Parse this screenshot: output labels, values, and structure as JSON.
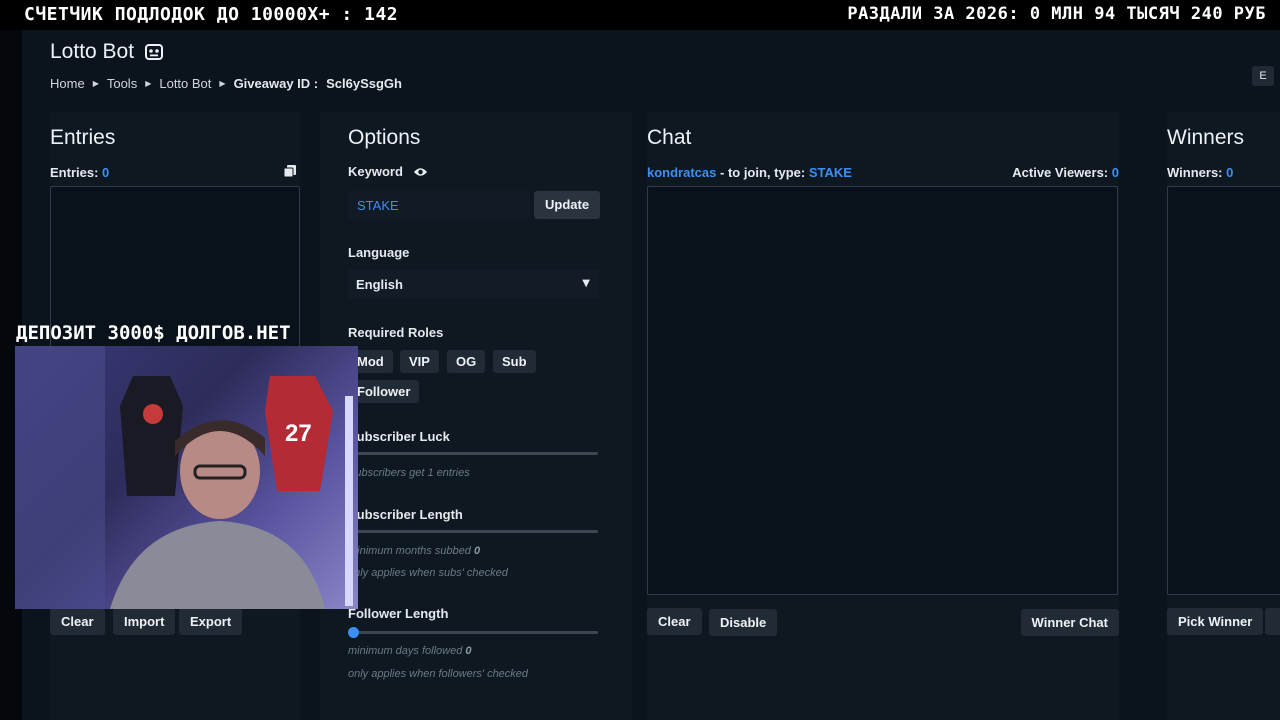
{
  "overlay": {
    "top_left": "СЧЕТЧИК ПОДЛОДОК ДО 10000Х+ : 142",
    "top_right": "РАЗДАЛИ ЗА 2026: 0 МЛН 94 ТЫСЯЧ 240 РУБ",
    "cam_label": "ДЕПОЗИТ 3000$ ДОЛГОВ.НЕТ"
  },
  "header": {
    "title": "Lotto Bot",
    "icon": "robot-icon",
    "breadcrumb": [
      "Home",
      "Tools",
      "Lotto Bot"
    ],
    "giveaway_label": "Giveaway ID :",
    "giveaway_id": "Scl6ySsgGh",
    "corner_button": "E"
  },
  "entries": {
    "title": "Entries",
    "count_label": "Entries:",
    "count": "0",
    "buttons": {
      "clear": "Clear",
      "import": "Import",
      "export": "Export"
    }
  },
  "options": {
    "title": "Options",
    "keyword_label": "Keyword",
    "keyword_value": "STAKE",
    "update": "Update",
    "language_label": "Language",
    "language_value": "English",
    "roles_label": "Required Roles",
    "roles": [
      "Mod",
      "VIP",
      "OG",
      "Sub",
      "Follower"
    ],
    "sub_luck_label": "Subscriber Luck",
    "sub_luck_note_pre": "Subscribers get",
    "sub_luck_value": "1",
    "sub_luck_note_post": "entries",
    "sub_length_label": "Subscriber Length",
    "sub_length_note": "minimum months subbed",
    "sub_length_value": "0",
    "sub_length_note2": "only applies when subs' checked",
    "follower_length_label": "Follower Length",
    "follower_length_note": "minimum days followed",
    "follower_length_value": "0",
    "follower_length_note2": "only applies when followers' checked",
    "follower_length_fraction": 0
  },
  "chat": {
    "title": "Chat",
    "channel": "kondratcas",
    "join_text": "- to join, type:",
    "join_keyword": "STAKE",
    "viewers_label": "Active Viewers:",
    "viewers": "0",
    "buttons": {
      "clear": "Clear",
      "disable": "Disable",
      "winner_chat": "Winner Chat"
    }
  },
  "winners": {
    "title": "Winners",
    "count_label": "Winners:",
    "count": "0",
    "pick": "Pick Winner"
  },
  "colors": {
    "accent": "#3d8ef5",
    "panel": "#0d1821",
    "background": "#0b141d"
  }
}
